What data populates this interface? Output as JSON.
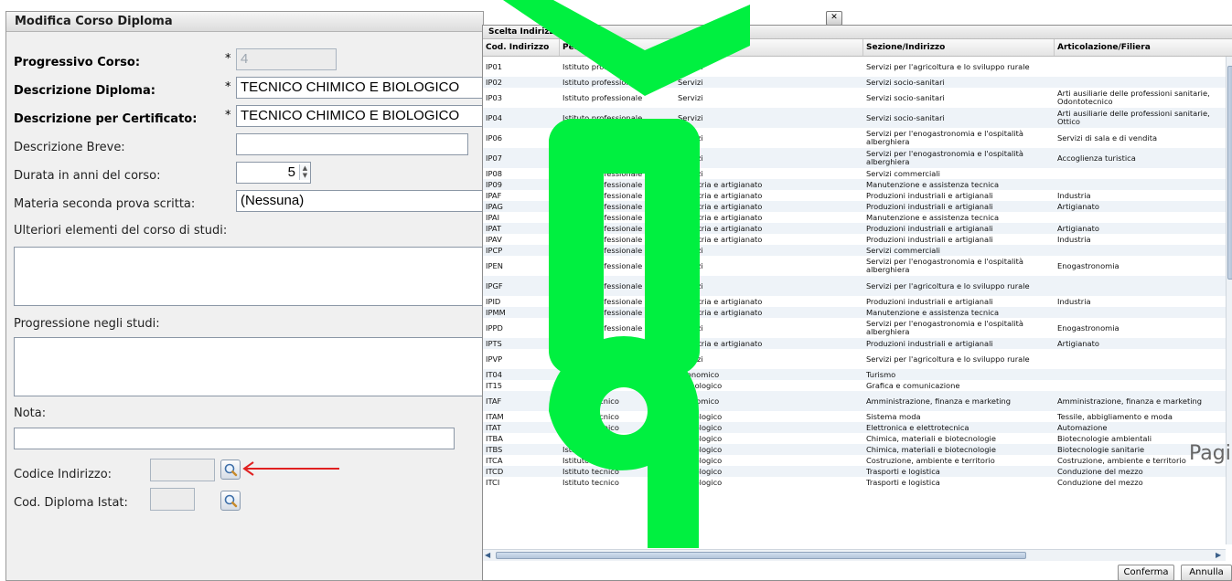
{
  "form": {
    "title": "Modifica Corso Diploma",
    "progressivo_label": "Progressivo Corso:",
    "progressivo_value": "4",
    "descrizione_label": "Descrizione Diploma:",
    "descrizione_value": "TECNICO CHIMICO E BIOLOGICO",
    "certificato_label": "Descrizione per Certificato:",
    "certificato_value": "TECNICO CHIMICO E BIOLOGICO",
    "breve_label": "Descrizione Breve:",
    "durata_label": "Durata in anni del corso:",
    "durata_value": "5",
    "materia_label": "Materia seconda prova scritta:",
    "materia_value": "(Nessuna)",
    "ulteriori_label": "Ulteriori elementi del corso di studi:",
    "progressione_label": "Progressione negli studi:",
    "nota_label": "Nota:",
    "codice_label": "Codice Indirizzo:",
    "istat_label": "Cod. Diploma Istat:",
    "required_mark": "*"
  },
  "dialog": {
    "title": "Scelta Indirizzo di Studio",
    "columns": [
      "Cod. Indirizzo",
      "Percorso",
      "Liceo/Settore",
      "Sezione/Indirizzo",
      "Articolazione/Filiera"
    ],
    "rows": [
      [
        "IP01",
        "Istituto professionale",
        "Servizi",
        "Servizi per l'agricoltura e lo sviluppo rurale",
        ""
      ],
      [
        "IP02",
        "Istituto professionale",
        "Servizi",
        "Servizi socio-sanitari",
        ""
      ],
      [
        "IP03",
        "Istituto professionale",
        "Servizi",
        "Servizi socio-sanitari",
        "Arti ausiliarie delle professioni sanitarie, Odontotecnico"
      ],
      [
        "IP04",
        "Istituto professionale",
        "Servizi",
        "Servizi socio-sanitari",
        "Arti ausiliarie delle professioni sanitarie, Ottico"
      ],
      [
        "IP06",
        "Istituto professionale",
        "Servizi",
        "Servizi per l'enogastronomia e l'ospitalità alberghiera",
        "Servizi di sala e di vendita"
      ],
      [
        "IP07",
        "Istituto professionale",
        "Servizi",
        "Servizi per l'enogastronomia e l'ospitalità alberghiera",
        "Accoglienza turistica"
      ],
      [
        "IP08",
        "Istituto professionale",
        "Servizi",
        "Servizi commerciali",
        ""
      ],
      [
        "IP09",
        "Istituto professionale",
        "Industria e artigianato",
        "Manutenzione e assistenza tecnica",
        ""
      ],
      [
        "IPAF",
        "Istituto professionale",
        "Industria e artigianato",
        "Produzioni industriali e artigianali",
        "Industria"
      ],
      [
        "IPAG",
        "Istituto professionale",
        "Industria e artigianato",
        "Produzioni industriali e artigianali",
        "Artigianato"
      ],
      [
        "IPAI",
        "Istituto professionale",
        "Industria e artigianato",
        "Manutenzione e assistenza tecnica",
        ""
      ],
      [
        "IPAT",
        "Istituto professionale",
        "Industria e artigianato",
        "Produzioni industriali e artigianali",
        "Artigianato"
      ],
      [
        "IPAV",
        "Istituto professionale",
        "Industria e artigianato",
        "Produzioni industriali e artigianali",
        "Industria"
      ],
      [
        "IPCP",
        "Istituto professionale",
        "Servizi",
        "Servizi commerciali",
        ""
      ],
      [
        "IPEN",
        "Istituto professionale",
        "Servizi",
        "Servizi per l'enogastronomia e l'ospitalità alberghiera",
        "Enogastronomia"
      ],
      [
        "IPGF",
        "Istituto professionale",
        "Servizi",
        "Servizi per l'agricoltura e lo sviluppo rurale",
        ""
      ],
      [
        "IPID",
        "Istituto professionale",
        "Industria e artigianato",
        "Produzioni industriali e artigianali",
        "Industria"
      ],
      [
        "IPMM",
        "Istituto professionale",
        "Industria e artigianato",
        "Manutenzione e assistenza tecnica",
        ""
      ],
      [
        "IPPD",
        "Istituto professionale",
        "Servizi",
        "Servizi per l'enogastronomia e l'ospitalità alberghiera",
        "Enogastronomia"
      ],
      [
        "IPTS",
        "Istituto professionale",
        "Industria e artigianato",
        "Produzioni industriali e artigianali",
        "Artigianato"
      ],
      [
        "IPVP",
        "Istituto professionale",
        "Servizi",
        "Servizi per l'agricoltura e lo sviluppo rurale",
        ""
      ],
      [
        "IT04",
        "Istituto tecnico",
        "Economico",
        "Turismo",
        ""
      ],
      [
        "IT15",
        "Istituto tecnico",
        "Tecnologico",
        "Grafica e comunicazione",
        ""
      ],
      [
        "ITAF",
        "Istituto tecnico",
        "Economico",
        "Amministrazione, finanza e marketing",
        "Amministrazione, finanza e marketing"
      ],
      [
        "ITAM",
        "Istituto tecnico",
        "Tecnologico",
        "Sistema moda",
        "Tessile, abbigliamento e moda"
      ],
      [
        "ITAT",
        "Istituto tecnico",
        "Tecnologico",
        "Elettronica e elettrotecnica",
        "Automazione"
      ],
      [
        "ITBA",
        "Istituto tecnico",
        "Tecnologico",
        "Chimica, materiali e biotecnologie",
        "Biotecnologie ambientali"
      ],
      [
        "ITBS",
        "Istituto tecnico",
        "Tecnologico",
        "Chimica, materiali e biotecnologie",
        "Biotecnologie sanitarie"
      ],
      [
        "ITCA",
        "Istituto tecnico",
        "Tecnologico",
        "Costruzione, ambiente e territorio",
        "Costruzione, ambiente e territorio"
      ],
      [
        "ITCD",
        "Istituto tecnico",
        "Tecnologico",
        "Trasporti e logistica",
        "Conduzione del mezzo"
      ],
      [
        "ITCI",
        "Istituto tecnico",
        "Tecnologico",
        "Trasporti e logistica",
        "Conduzione del mezzo"
      ]
    ],
    "confirm_label": "Conferma",
    "cancel_label": "Annulla",
    "close_glyph": "✕"
  },
  "overlay_text": "Pagi",
  "colors": {
    "watermark": "#00f040",
    "arrow": "#e02020"
  }
}
